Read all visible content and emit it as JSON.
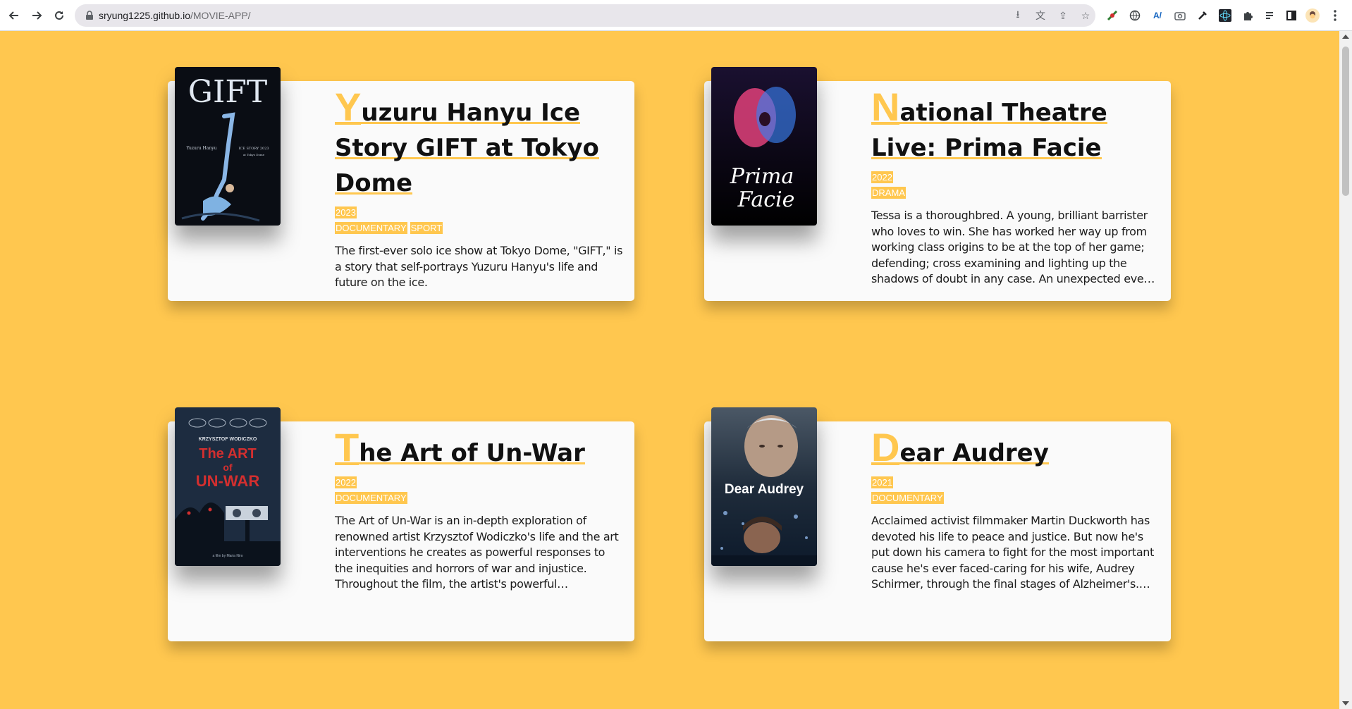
{
  "browser": {
    "url_host": "sryung1225.github.io",
    "url_path": "/MOVIE-APP/"
  },
  "accent_color": "#ffc74f",
  "movies": [
    {
      "title_first": "Y",
      "title_rest": "uzuru Hanyu Ice Story GIFT at Tokyo Dome",
      "year": "2023",
      "genres": [
        "DOCUMENTARY",
        "SPORT"
      ],
      "summary": "The first-ever solo ice show at Tokyo Dome, \"GIFT,\" is a story that self-portrays Yuzuru Hanyu's life and future on the ice.",
      "poster": {
        "title": "GIFT",
        "line1": "Yuzuru Hanyu",
        "line2": "ICE STORY 2023",
        "line3": "at Tokyo Dome"
      }
    },
    {
      "title_first": "N",
      "title_rest": "ational Theatre Live: Prima Facie",
      "year": "2022",
      "genres": [
        "DRAMA"
      ],
      "summary": "Tessa is a thoroughbred. A young, brilliant barrister who loves to win. She has worked her way up from working class origins to be at the top of her game; defending; cross examining and lighting up the shadows of doubt in any case. An unexpected event forces her to confro...",
      "poster": {
        "title_line1": "Prima",
        "title_line2": "Facie"
      }
    },
    {
      "title_first": "T",
      "title_rest": "he Art of Un-War",
      "year": "2022",
      "genres": [
        "DOCUMENTARY"
      ],
      "summary": "The Art of Un-War is an in-depth exploration of renowned artist Krzysztof Wodiczko's life and the art interventions he creates as powerful responses to the inequities and horrors of war and injustice. Throughout the film, the artist's powerful interventions become...",
      "poster": {
        "artist": "KRZYSZTOF WODICZKO",
        "line1": "The ART",
        "line2": "of",
        "line3": "UN-WAR",
        "credit": "a film by Maria Niro"
      }
    },
    {
      "title_first": "D",
      "title_rest": "ear Audrey",
      "year": "2021",
      "genres": [
        "DOCUMENTARY"
      ],
      "summary": "Acclaimed activist filmmaker Martin Duckworth has devoted his life to peace and justice. But now he's put down his camera to fight for the most important cause he's ever faced-caring for his wife, Audrey Schirmer, through the final stages of Alzheimer's. Martin tirelessl...",
      "poster": {
        "title": "Dear Audrey"
      }
    }
  ]
}
